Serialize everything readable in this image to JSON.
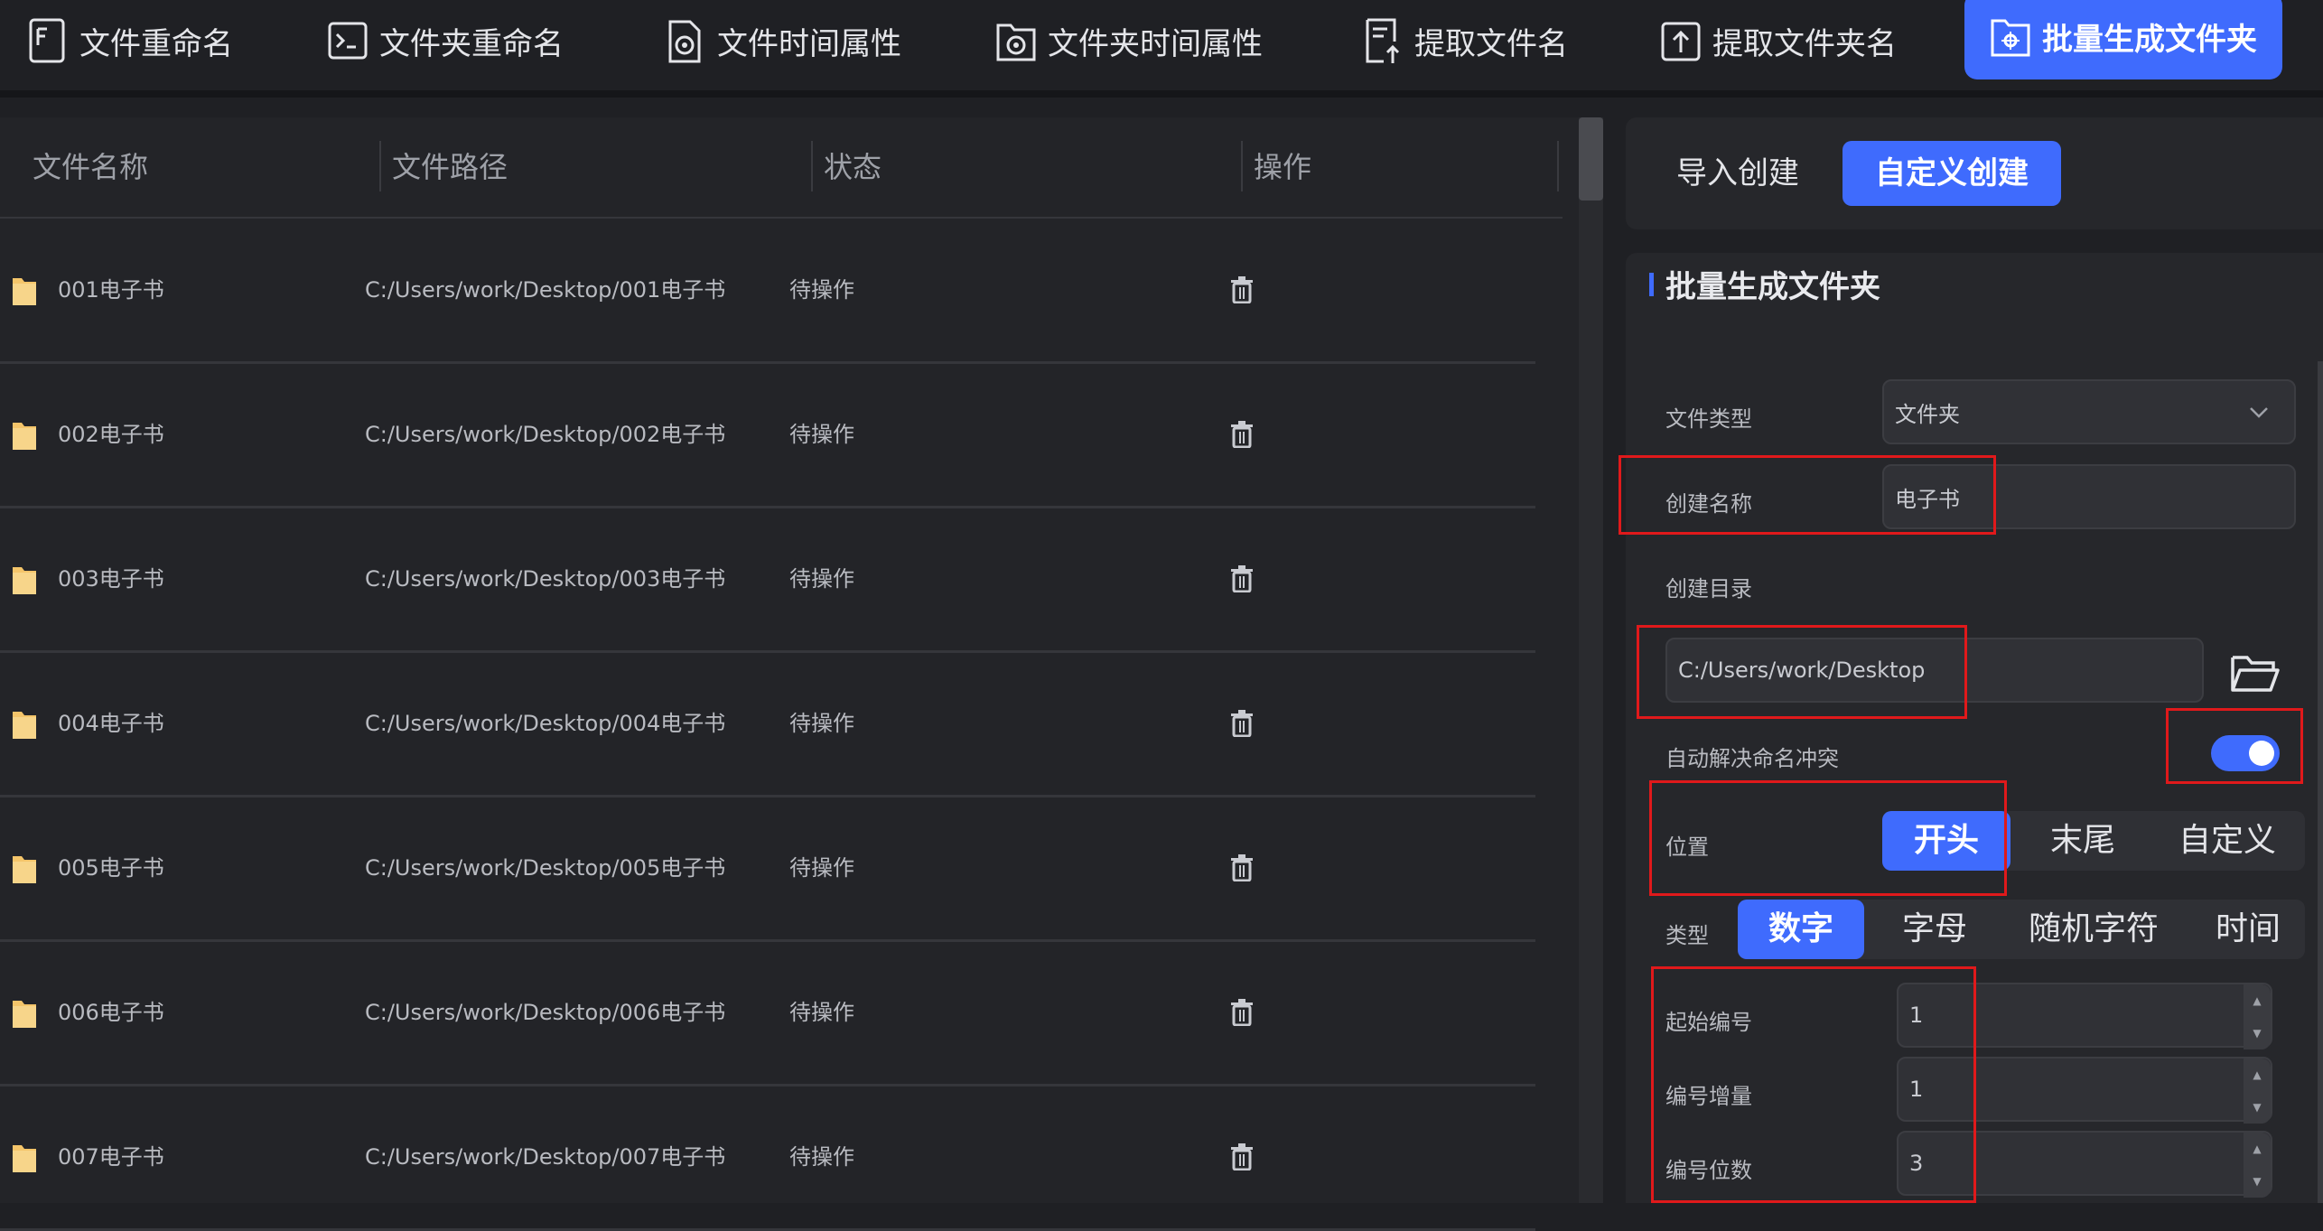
{
  "toolbar": {
    "tabs": [
      {
        "label": "文件重命名",
        "icon": "file-rename-icon"
      },
      {
        "label": "文件夹重命名",
        "icon": "folder-rename-icon"
      },
      {
        "label": "文件时间属性",
        "icon": "file-time-icon"
      },
      {
        "label": "文件夹时间属性",
        "icon": "folder-time-icon"
      },
      {
        "label": "提取文件名",
        "icon": "extract-filename-icon"
      },
      {
        "label": "提取文件夹名",
        "icon": "extract-foldername-icon"
      },
      {
        "label": "批量生成文件夹",
        "icon": "batch-create-folder-icon",
        "active": true
      }
    ]
  },
  "table": {
    "columns": [
      "文件名称",
      "文件路径",
      "状态",
      "操作"
    ],
    "rows": [
      {
        "name": "001电子书",
        "path": "C:/Users/work/Desktop/001电子书",
        "status": "待操作"
      },
      {
        "name": "002电子书",
        "path": "C:/Users/work/Desktop/002电子书",
        "status": "待操作"
      },
      {
        "name": "003电子书",
        "path": "C:/Users/work/Desktop/003电子书",
        "status": "待操作"
      },
      {
        "name": "004电子书",
        "path": "C:/Users/work/Desktop/004电子书",
        "status": "待操作"
      },
      {
        "name": "005电子书",
        "path": "C:/Users/work/Desktop/005电子书",
        "status": "待操作"
      },
      {
        "name": "006电子书",
        "path": "C:/Users/work/Desktop/006电子书",
        "status": "待操作"
      },
      {
        "name": "007电子书",
        "path": "C:/Users/work/Desktop/007电子书",
        "status": "待操作"
      }
    ]
  },
  "panel": {
    "mode_tabs": [
      "导入创建",
      "自定义创建"
    ],
    "section_title": "批量生成文件夹",
    "file_type_label": "文件类型",
    "file_type_value": "文件夹",
    "create_name_label": "创建名称",
    "create_name_value": "电子书",
    "create_dir_label": "创建目录",
    "create_dir_value": "C:/Users/work/Desktop",
    "auto_resolve_label": "自动解决命名冲突",
    "auto_resolve_on": true,
    "position_label": "位置",
    "position_options": [
      "开头",
      "末尾",
      "自定义"
    ],
    "type_label": "类型",
    "type_options": [
      "数字",
      "字母",
      "随机字符",
      "时间"
    ],
    "start_no_label": "起始编号",
    "start_no_value": "1",
    "increment_label": "编号增量",
    "increment_value": "1",
    "digits_label": "编号位数",
    "digits_value": "3"
  },
  "colors": {
    "accent": "#3f6bfd",
    "highlight_box": "#e0191b",
    "folder": "#f4c56a"
  }
}
